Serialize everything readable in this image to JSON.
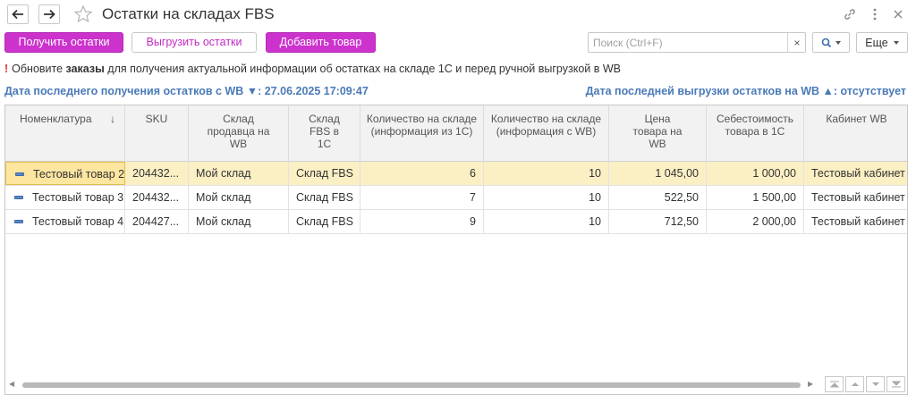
{
  "window": {
    "title": "Остатки на складах FBS"
  },
  "toolbar": {
    "get_label": "Получить остатки",
    "upload_label": "Выгрузить остатки",
    "add_label": "Добавить товар",
    "search_placeholder": "Поиск (Ctrl+F)",
    "search_clear": "×",
    "more_label": "Еще"
  },
  "notice": {
    "excl": "!",
    "before": "Обновите ",
    "bold": "заказы",
    "after": " для получения актуальной информации об остатках на складе 1С и перед ручной выгрузкой в WB"
  },
  "dates": {
    "last_receive": "Дата последнего получения остатков с WB ▼: 27.06.2025 17:09:47",
    "last_upload": "Дата последней выгрузки остатков на WB ▲: отсутствует"
  },
  "table": {
    "columns": [
      "Номенклатура",
      "SKU",
      "Склад продавца на WB",
      "Склад FBS в 1С",
      "Количество на складе (информация из 1С)",
      "Количество на складе (информация с WB)",
      "Цена товара на WB",
      "Себестоимость товара в 1С",
      "Кабинет WB"
    ],
    "sort_indicator": "↓",
    "rows": [
      [
        "Тестовый товар 2",
        "204432...",
        "Мой склад",
        "Склад FBS",
        "6",
        "10",
        "1 045,00",
        "1 000,00",
        "Тестовый кабинет"
      ],
      [
        "Тестовый товар 3",
        "204432...",
        "Мой склад",
        "Склад FBS",
        "7",
        "10",
        "522,50",
        "1 500,00",
        "Тестовый кабинет"
      ],
      [
        "Тестовый товар 4",
        "204427...",
        "Мой склад",
        "Склад FBS",
        "9",
        "10",
        "712,50",
        "2 000,00",
        "Тестовый кабинет"
      ]
    ],
    "selected_row": 0
  },
  "colors": {
    "accent": "#cc33cc",
    "link": "#4a7ab8",
    "selection": "#fbefc4"
  }
}
